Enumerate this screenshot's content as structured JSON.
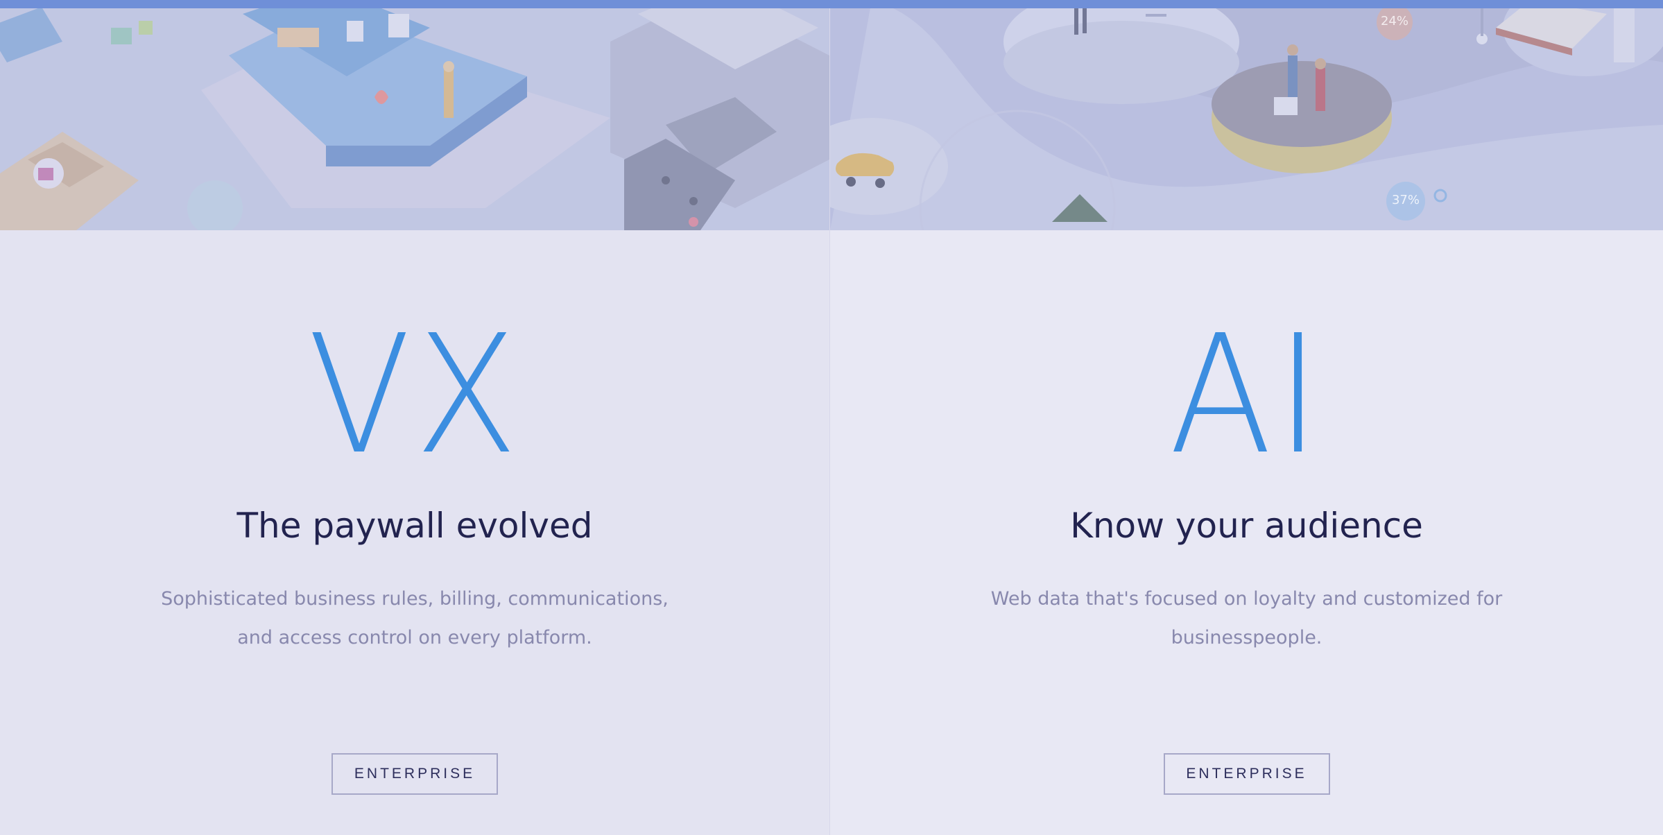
{
  "panels": [
    {
      "logo": "VX",
      "tagline": "The paywall evolved",
      "description": "Sophisticated business rules, billing, communications, and access control on every platform.",
      "button_label": "ENTERPRISE"
    },
    {
      "logo": "AI",
      "tagline": "Know your audience",
      "description": "Web data that's focused on loyalty and customized for businesspeople.",
      "button_label": "ENTERPRISE"
    }
  ],
  "hero_badges": {
    "stat_one": "24%",
    "stat_two": "37%"
  },
  "colors": {
    "accent": "#3c8ee0",
    "heading": "#22234f",
    "body_text": "#8888ad",
    "top_strip": "#6f8fd8"
  }
}
